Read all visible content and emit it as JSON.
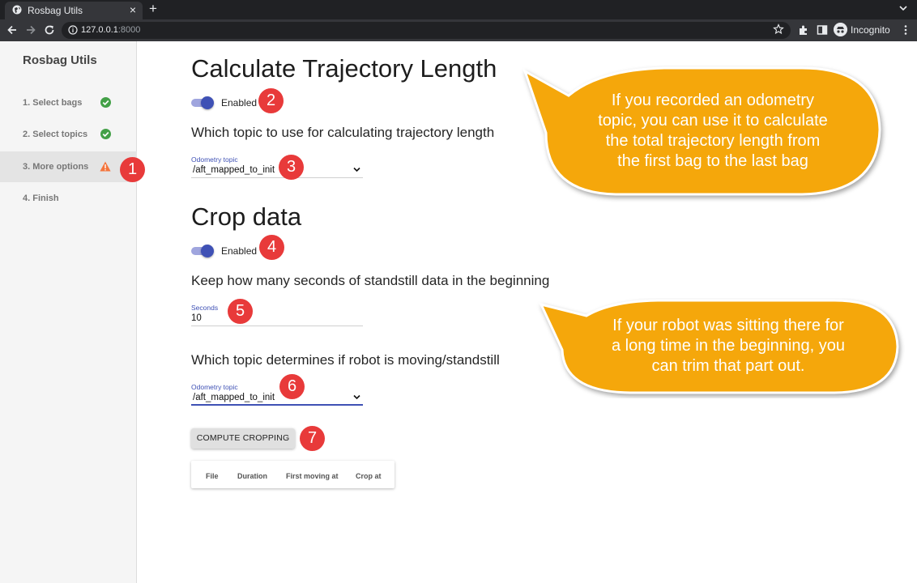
{
  "browser": {
    "tab_title": "Rosbag Utils",
    "new_tab_symbol": "+",
    "close_symbol": "×",
    "url_host": "127.0.0.1",
    "url_port": ":8000",
    "profile_label": "Incognito"
  },
  "sidebar": {
    "title": "Rosbag Utils",
    "steps": [
      {
        "label": "1. Select bags",
        "status": "done",
        "icon": "check-circle-icon"
      },
      {
        "label": "2. Select topics",
        "status": "done",
        "icon": "check-circle-icon"
      },
      {
        "label": "3. More options",
        "status": "warning",
        "icon": "warning-icon",
        "active": true
      },
      {
        "label": "4. Finish",
        "status": "pending"
      }
    ]
  },
  "trajectory": {
    "heading": "Calculate Trajectory Length",
    "toggle_label": "Enabled",
    "toggle_on": true,
    "question": "Which topic to use for calculating trajectory length",
    "field_label": "Odometry topic",
    "field_value": "/aft_mapped_to_init"
  },
  "crop": {
    "heading": "Crop data",
    "toggle_label": "Enabled",
    "toggle_on": true,
    "seconds_question": "Keep how many seconds of standstill data in the beginning",
    "seconds_label": "Seconds",
    "seconds_value": "10",
    "moving_question": "Which topic determines if robot is moving/standstill",
    "moving_field_label": "Odometry topic",
    "moving_field_value": "/aft_mapped_to_init",
    "compute_button": "COMPUTE CROPPING",
    "table_headers": [
      "File",
      "Duration",
      "First moving at",
      "Crop at"
    ]
  },
  "annotations": {
    "badges": [
      "1",
      "2",
      "3",
      "4",
      "5",
      "6",
      "7"
    ],
    "callout_trajectory": [
      "If you recorded an odometry",
      "topic, you can use it to calculate",
      "the total trajectory length from",
      "the first bag to the last bag"
    ],
    "callout_crop": [
      "If your robot was sitting there for",
      "a long time in the beginning, you",
      "can trim that part out."
    ]
  },
  "colors": {
    "accent": "#3f51b5",
    "success": "#43a047",
    "warning": "#f4743b",
    "badge": "#e83a3a",
    "callout": "#f5a70b"
  }
}
